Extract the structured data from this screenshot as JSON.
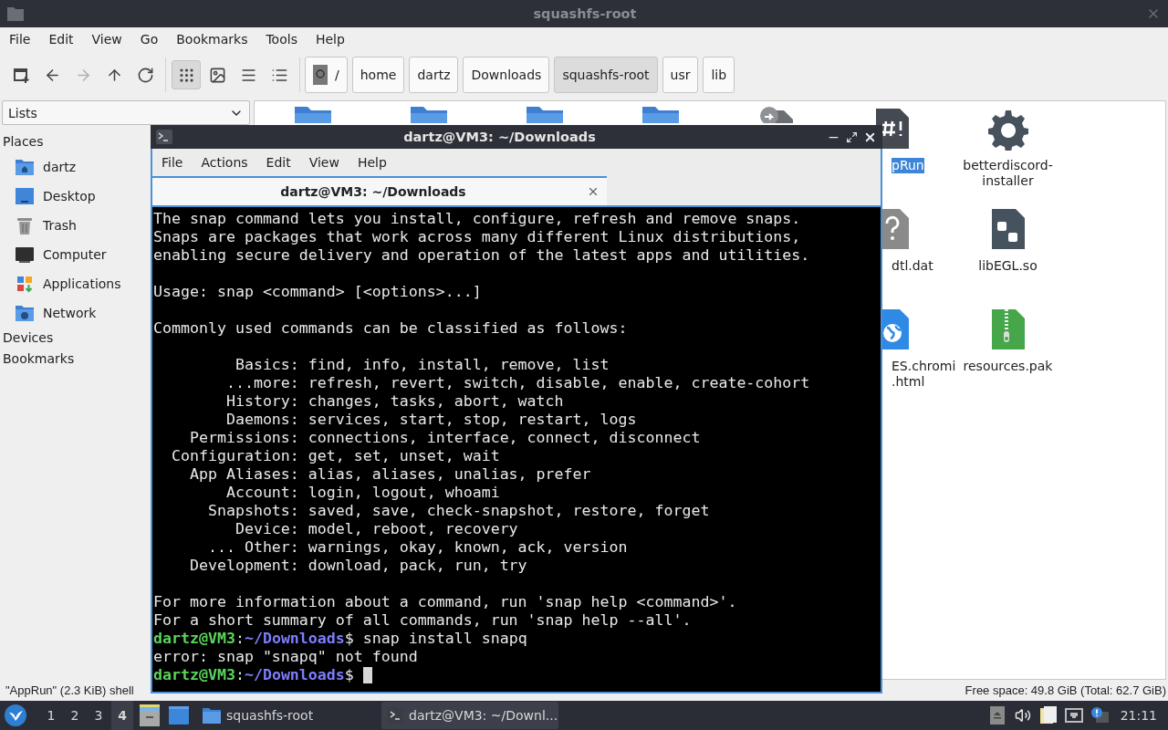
{
  "window": {
    "title": "squashfs-root"
  },
  "menu": [
    "File",
    "Edit",
    "View",
    "Go",
    "Bookmarks",
    "Tools",
    "Help"
  ],
  "toolbar": {
    "buttons": [
      {
        "kind": "new-window",
        "disabled": false
      },
      {
        "kind": "back",
        "disabled": false
      },
      {
        "kind": "forward",
        "disabled": true
      },
      {
        "kind": "up",
        "disabled": false
      },
      {
        "kind": "reload",
        "disabled": false
      }
    ],
    "views": [
      {
        "kind": "icons",
        "selected": true
      },
      {
        "kind": "thumbnails",
        "selected": false
      },
      {
        "kind": "compact",
        "selected": false
      },
      {
        "kind": "details",
        "selected": false
      }
    ],
    "path": [
      {
        "label": "/",
        "kind": "root",
        "selected": false
      },
      {
        "label": "home",
        "kind": "dir",
        "selected": false
      },
      {
        "label": "dartz",
        "kind": "dir",
        "selected": false
      },
      {
        "label": "Downloads",
        "kind": "dir",
        "selected": false
      },
      {
        "label": "squashfs-root",
        "kind": "dir",
        "selected": true
      },
      {
        "label": "usr",
        "kind": "dir",
        "selected": false
      },
      {
        "label": "lib",
        "kind": "dir",
        "selected": false
      }
    ]
  },
  "sidebar": {
    "mode": "Lists",
    "places_title": "Places",
    "places": [
      {
        "label": "dartz",
        "kind": "home"
      },
      {
        "label": "Desktop",
        "kind": "desktop"
      },
      {
        "label": "Trash",
        "kind": "trash"
      },
      {
        "label": "Computer",
        "kind": "computer"
      },
      {
        "label": "Applications",
        "kind": "apps"
      },
      {
        "label": "Network",
        "kind": "network"
      }
    ],
    "sections": [
      "Devices",
      "Bookmarks"
    ]
  },
  "files": [
    [
      {
        "kind": "folder"
      },
      {
        "kind": "folder"
      },
      {
        "kind": "folder"
      },
      {
        "kind": "folder"
      },
      {
        "kind": "link"
      },
      {
        "kind": "script",
        "label": "pRun",
        "selected": true
      },
      {
        "kind": "gear",
        "label": "betterdiscord-installer",
        "selected": false
      }
    ],
    [
      {
        "kind": "unknown",
        "label": "dtl.dat",
        "selected": false
      },
      {
        "kind": "library",
        "label": "libEGL.so",
        "selected": false
      }
    ],
    [
      {
        "kind": "web",
        "label": "ES.chromi\n.html",
        "selected": false
      },
      {
        "kind": "archive",
        "label": "resources.pak",
        "selected": false
      }
    ]
  ],
  "status_bar": {
    "selection": "\"AppRun\" (2.3 KiB) shell",
    "free_space": "Free space: 49.8 GiB (Total: 62.7 GiB)"
  },
  "terminal": {
    "title": "dartz@VM3: ~/Downloads",
    "menu": [
      "File",
      "Actions",
      "Edit",
      "View",
      "Help"
    ],
    "tabs": [
      {
        "label": "dartz@VM3: ~/Downloads",
        "selected": true
      }
    ],
    "lines": [
      {
        "kind": "text",
        "text": "The snap command lets you install, configure, refresh and remove snaps."
      },
      {
        "kind": "text",
        "text": "Snaps are packages that work across many different Linux distributions,"
      },
      {
        "kind": "text",
        "text": "enabling secure delivery and operation of the latest apps and utilities."
      },
      {
        "kind": "blank"
      },
      {
        "kind": "text",
        "text": "Usage: snap <command> [<options>...]"
      },
      {
        "kind": "blank"
      },
      {
        "kind": "text",
        "text": "Commonly used commands can be classified as follows:"
      },
      {
        "kind": "blank"
      },
      {
        "kind": "text",
        "text": "         Basics: find, info, install, remove, list"
      },
      {
        "kind": "text",
        "text": "        ...more: refresh, revert, switch, disable, enable, create-cohort"
      },
      {
        "kind": "text",
        "text": "        History: changes, tasks, abort, watch"
      },
      {
        "kind": "text",
        "text": "        Daemons: services, start, stop, restart, logs"
      },
      {
        "kind": "text",
        "text": "    Permissions: connections, interface, connect, disconnect"
      },
      {
        "kind": "text",
        "text": "  Configuration: get, set, unset, wait"
      },
      {
        "kind": "text",
        "text": "    App Aliases: alias, aliases, unalias, prefer"
      },
      {
        "kind": "text",
        "text": "        Account: login, logout, whoami"
      },
      {
        "kind": "text",
        "text": "      Snapshots: saved, save, check-snapshot, restore, forget"
      },
      {
        "kind": "text",
        "text": "         Device: model, reboot, recovery"
      },
      {
        "kind": "text",
        "text": "      ... Other: warnings, okay, known, ack, version"
      },
      {
        "kind": "text",
        "text": "    Development: download, pack, run, try"
      },
      {
        "kind": "blank"
      },
      {
        "kind": "text",
        "text": "For more information about a command, run 'snap help <command>'."
      },
      {
        "kind": "text",
        "text": "For a short summary of all commands, run 'snap help --all'."
      },
      {
        "kind": "prompt",
        "user": "dartz@VM3",
        "sep": ":",
        "path": "~/Downloads",
        "command": "$ snap install snapq",
        "cursor": false
      },
      {
        "kind": "text",
        "text": "error: snap \"snapq\" not found"
      },
      {
        "kind": "prompt",
        "user": "dartz@VM3",
        "sep": ":",
        "path": "~/Downloads",
        "command": "$",
        "cursor": true
      }
    ]
  },
  "taskbar": {
    "workspaces": [
      {
        "label": "1",
        "selected": false
      },
      {
        "label": "2",
        "selected": false
      },
      {
        "label": "3",
        "selected": false
      },
      {
        "label": "4",
        "selected": true
      }
    ],
    "tasks": [
      {
        "label": "squashfs-root",
        "kind": "folder",
        "selected": false
      },
      {
        "label": "dartz@VM3: ~/Downl...",
        "kind": "terminal",
        "selected": true
      }
    ],
    "clock": "21:11"
  }
}
